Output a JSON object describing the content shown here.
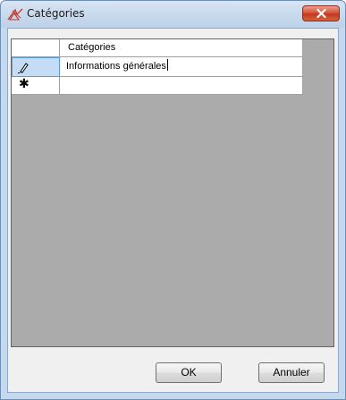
{
  "window": {
    "title": "Catégories",
    "close_label": "×"
  },
  "grid": {
    "column_header": "Catégories",
    "rows": [
      {
        "indicator_icon": "pencil-icon",
        "value": "Informations générales",
        "editing": true
      },
      {
        "indicator_icon": "new-row-asterisk-icon",
        "indicator_glyph": "✱",
        "value": "",
        "editing": false
      }
    ]
  },
  "buttons": {
    "ok_label": "OK",
    "cancel_label": "Annuler"
  },
  "colors": {
    "grid_background": "#ababab",
    "active_row_header": "#c5dcf7",
    "close_button": "#c94f33"
  }
}
